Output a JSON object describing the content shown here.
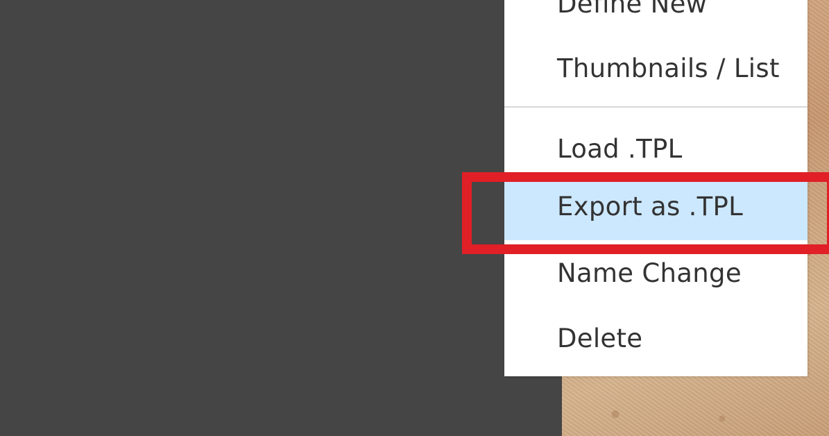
{
  "context_menu": {
    "items": [
      {
        "label": "Define New"
      },
      {
        "label": "Thumbnails / List"
      },
      {
        "label": "Load .TPL"
      },
      {
        "label": "Export as .TPL"
      },
      {
        "label": "Name Change"
      },
      {
        "label": "Delete"
      }
    ],
    "highlighted_item": "Export as .TPL"
  },
  "colors": {
    "background_panel": "#454545",
    "menu_background": "#ffffff",
    "highlight_fill": "#cce8ff",
    "annotation_border": "#e01f26",
    "text": "#333333"
  }
}
